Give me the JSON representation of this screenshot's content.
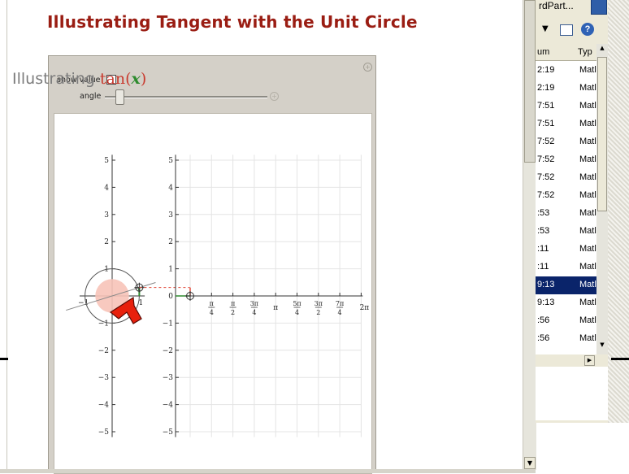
{
  "background_window": {
    "top_text": "rdPart...",
    "list_headers": [
      "um",
      "Typ"
    ],
    "rows": [
      {
        "time": "2:19",
        "type": "Matl"
      },
      {
        "time": "2:19",
        "type": "Matl"
      },
      {
        "time": "7:51",
        "type": "Matl"
      },
      {
        "time": "7:51",
        "type": "Matl"
      },
      {
        "time": "7:52",
        "type": "Matl"
      },
      {
        "time": "7:52",
        "type": "Matl"
      },
      {
        "time": "7:52",
        "type": "Matl"
      },
      {
        "time": "7:52",
        "type": "Matl"
      },
      {
        "time": ":53",
        "type": "Matl"
      },
      {
        "time": ":53",
        "type": "Matl"
      },
      {
        "time": ":11",
        "type": "Matl"
      },
      {
        "time": ":11",
        "type": "Matl"
      },
      {
        "time": "9:13",
        "type": "Matl",
        "selected": true
      },
      {
        "time": "9:13",
        "type": "Matl"
      },
      {
        "time": ":56",
        "type": "Matl"
      },
      {
        "time": ":56",
        "type": "Matl"
      }
    ],
    "icons": [
      "search-icon",
      "dropdown-arrow-icon",
      "view-icon",
      "help-icon"
    ]
  },
  "document": {
    "title": "Illustrating Tangent with the Unit Circle"
  },
  "manipulate": {
    "show_value_label": "show value",
    "show_value_checked": false,
    "angle_label": "angle",
    "angle_slider_fraction": 0.07,
    "plot_title_text": "Illustrating ",
    "plot_title_fn": "tan(",
    "plot_title_var": "x",
    "plot_title_close": ")"
  },
  "unit_circle": {
    "y_ticks": [
      "5",
      "4",
      "3",
      "2",
      "1",
      "−1",
      "−2",
      "−3",
      "−4",
      "−5"
    ],
    "x_ticks": [
      "−1",
      "1"
    ]
  },
  "graph": {
    "y_ticks": [
      "5",
      "4",
      "3",
      "2",
      "1",
      "0",
      "−1",
      "−2",
      "−3",
      "−4",
      "−5"
    ],
    "x_ticks": [
      {
        "num": "π",
        "den": "4"
      },
      {
        "num": "π",
        "den": "2"
      },
      {
        "num": "3π",
        "den": "4"
      },
      {
        "label": "π"
      },
      {
        "num": "5π",
        "den": "4"
      },
      {
        "num": "3π",
        "den": "2"
      },
      {
        "num": "7π",
        "den": "4"
      },
      {
        "label": "2π"
      }
    ]
  },
  "colors": {
    "title": "#9a1d13",
    "tan_fn": "#c93a2e",
    "var": "#2e8b2e",
    "cursor": "#e8200c",
    "selected_row": "#0a246a"
  }
}
